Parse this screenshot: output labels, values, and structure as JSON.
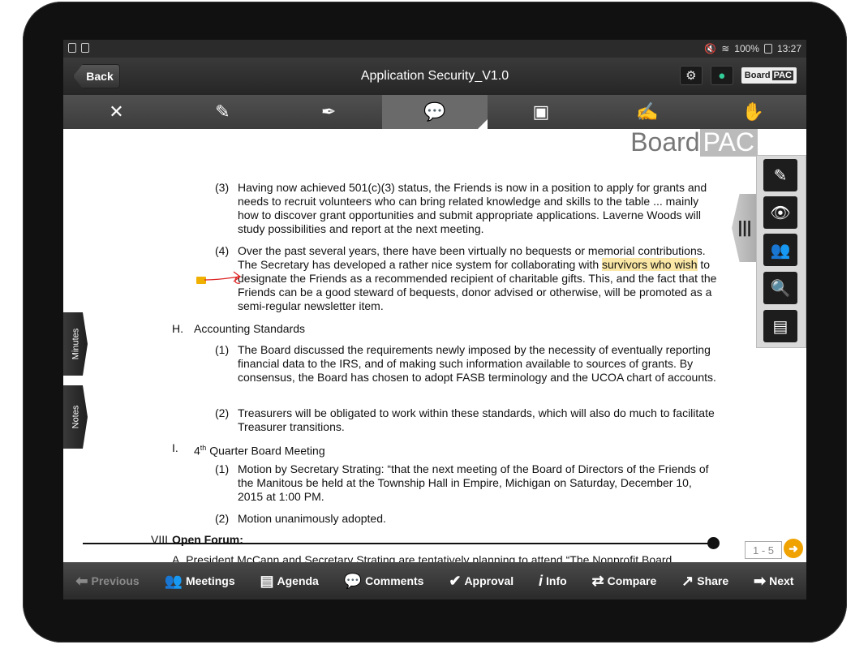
{
  "status_bar": {
    "battery": "100%",
    "time": "13:27"
  },
  "titlebar": {
    "back_label": "Back",
    "title": "Application Security_V1.0",
    "brand_board": "Board",
    "brand_pac": "PAC"
  },
  "toolbar": {
    "close": "✕",
    "highlight": "✎",
    "pen": "✒",
    "comment": "💬",
    "image": "▣",
    "signature": "✍",
    "hand": "✋"
  },
  "watermark": {
    "board": "Board",
    "pac": "PAC"
  },
  "side_tabs": {
    "minutes": "Minutes",
    "notes": "Notes"
  },
  "right_panel": {
    "edit": "✎",
    "view": "👁",
    "users": "👥",
    "search": "🔍",
    "other": "▤"
  },
  "document": {
    "item3_num": "(3)",
    "item3_text": "Having now achieved 501(c)(3) status, the Friends is now in a position to apply for grants and needs to recruit volunteers who can bring related knowledge and skills to the table ... mainly how to discover grant opportunities and submit appropriate applications. Laverne Woods will study possibilities and report at the next meeting.",
    "item4_num": "(4)",
    "item4_text_a": "Over the past several years, there have been virtually no bequests or memorial contributions. The Secretary has developed a rather nice system for collaborating with",
    "item4_highlight": "survivors who wish",
    "item4_text_b": " to designate the Friends as a recommended recipient of charitable gifts. This, and the fact that the Friends can be a good steward of bequests, donor advised or otherwise, will be promoted as a semi-regular newsletter item.",
    "h_label": "H.",
    "h_title": "Accounting Standards",
    "h1_num": "(1)",
    "h1_text": "The Board discussed the requirements newly imposed by the necessity of eventually reporting financial data to the IRS, and of making such information available to sources of grants. By consensus, the Board has chosen to adopt FASB terminology and the UCOA chart of accounts.",
    "h2_num": "(2)",
    "h2_text": "Treasurers will be obligated to work within these standards, which will also do much to facilitate Treasurer transitions.",
    "i_label": "I.",
    "i_title_a": "4",
    "i_title_sup": "th",
    "i_title_b": " Quarter Board Meeting",
    "i1_num": "(1)",
    "i1_text": "Motion by Secretary Strating: “that the next meeting of the Board of Directors of the Friends of the Manitous be held at the Township Hall in Empire, Michigan on Saturday, December 10, 2015 at 1:00 PM.",
    "i2_num": "(2)",
    "i2_text": "Motion unanimously adopted.",
    "viii_label": "VIII",
    "viii_title": "Open Forum:",
    "a_cut": "A.    President McCann and Secretary Strating are tentatively planning to attend “The Nonprofit Board"
  },
  "pager": {
    "page": "1 - 5"
  },
  "bottom_bar": {
    "previous": "Previous",
    "meetings": "Meetings",
    "agenda": "Agenda",
    "comments": "Comments",
    "approval": "Approval",
    "info": "Info",
    "compare": "Compare",
    "share": "Share",
    "next": "Next"
  }
}
